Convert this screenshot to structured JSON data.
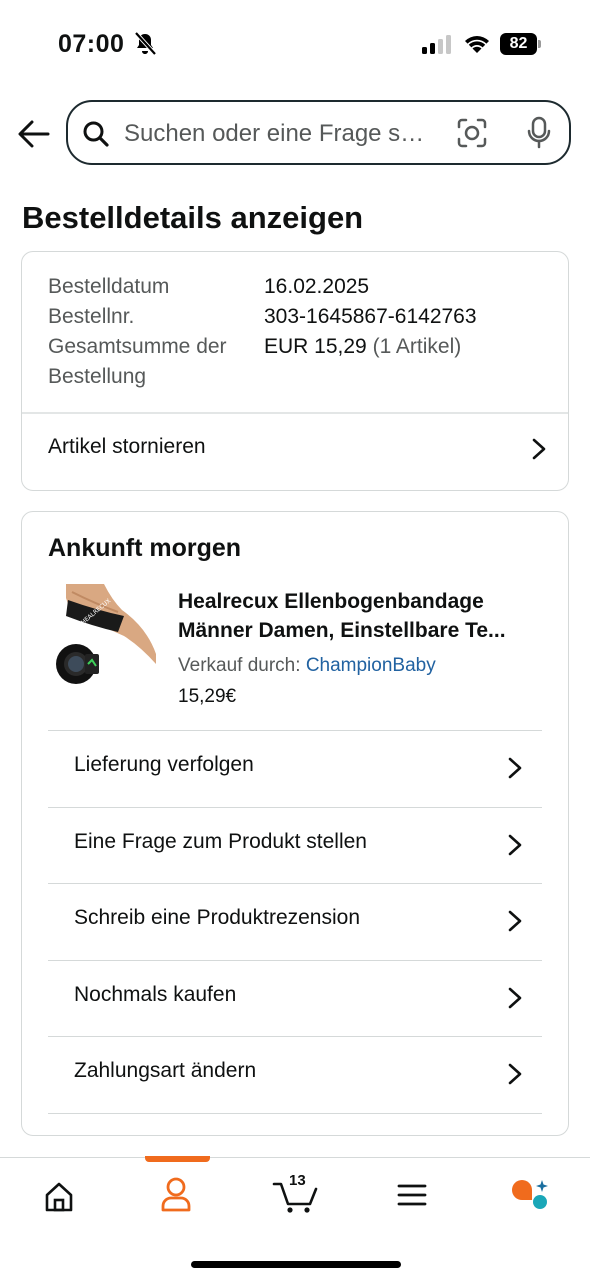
{
  "status_bar": {
    "time": "07:00",
    "battery": "82"
  },
  "search": {
    "placeholder": "Suchen oder eine Frage s…"
  },
  "page": {
    "title": "Bestelldetails anzeigen"
  },
  "order_summary": {
    "rows": [
      {
        "label": "Bestelldatum",
        "value": "16.02.2025"
      },
      {
        "label": "Bestellnr.",
        "value": "303-1645867-6142763"
      },
      {
        "label": "Gesamtsumme der Bestellung",
        "value": "EUR 15,29",
        "value_extra": "(1 Artikel)"
      }
    ],
    "cancel_label": "Artikel stornieren"
  },
  "shipment": {
    "arrival": "Ankunft morgen",
    "product": {
      "name_line1": "Healrecux Ellenbogenbandage",
      "name_line2": "Männer Damen, Einstellbare Te...",
      "seller_prefix": "Verkauf durch:",
      "seller": "ChampionBaby",
      "price": "15,29€",
      "image_brand": "HEALRECUX"
    },
    "actions": [
      {
        "label": "Lieferung verfolgen"
      },
      {
        "label": "Eine Frage zum Produkt stellen"
      },
      {
        "label": "Schreib eine Produktrezension"
      },
      {
        "label": "Nochmals kaufen"
      },
      {
        "label": "Zahlungsart ändern"
      }
    ]
  },
  "bottom_nav": {
    "items": [
      "home-icon",
      "account-icon",
      "cart-icon",
      "menu-icon",
      "rufus-assistant-icon"
    ],
    "active": "account-icon",
    "cart_count": "13"
  },
  "colors": {
    "accent": "#f06b1d",
    "link": "#2162a1",
    "text": "#0f1111",
    "muted": "#565959",
    "border": "#d5d9d9"
  }
}
